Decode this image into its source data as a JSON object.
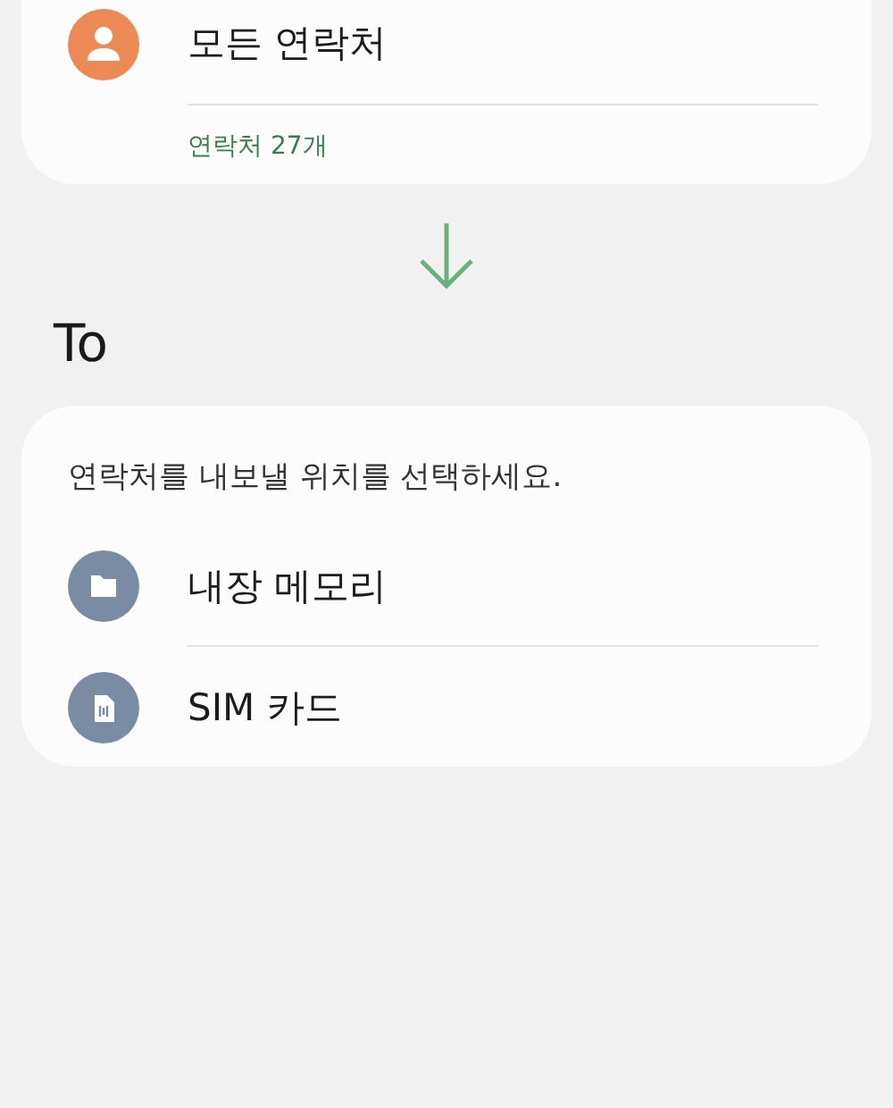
{
  "source": {
    "title": "모든 연락처",
    "count": "연락처 27개"
  },
  "to_heading": "To",
  "destination": {
    "prompt": "연락처를 내보낼 위치를 선택하세요.",
    "options": [
      {
        "kind": "folder",
        "label": "내장 메모리"
      },
      {
        "kind": "sim",
        "label": "SIM 카드"
      }
    ]
  }
}
